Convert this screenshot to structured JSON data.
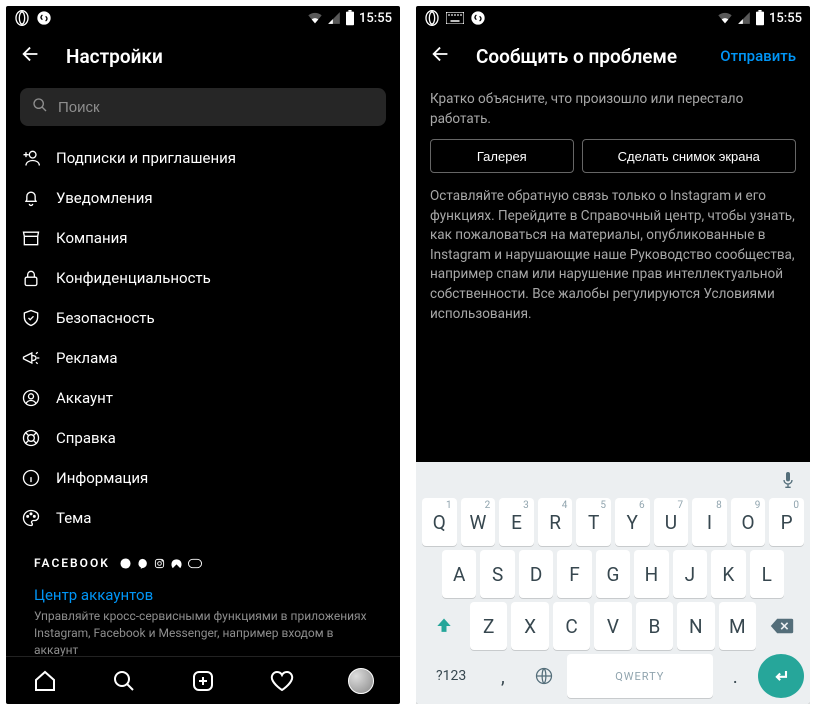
{
  "status": {
    "time": "15:55"
  },
  "left": {
    "title": "Настройки",
    "search_placeholder": "Поиск",
    "items": [
      {
        "label": "Подписки и приглашения"
      },
      {
        "label": "Уведомления"
      },
      {
        "label": "Компания"
      },
      {
        "label": "Конфиденциальность"
      },
      {
        "label": "Безопасность"
      },
      {
        "label": "Реклама"
      },
      {
        "label": "Аккаунт"
      },
      {
        "label": "Справка"
      },
      {
        "label": "Информация"
      },
      {
        "label": "Тема"
      }
    ],
    "facebook_label": "FACEBOOK",
    "accounts_center": "Центр аккаунтов",
    "fb_desc": "Управляйте кросс-сервисными функциями в приложениях Instagram, Facebook и Messenger, например входом в аккаунт"
  },
  "right": {
    "title": "Сообщить о проблеме",
    "send": "Отправить",
    "hint": "Кратко объясните, что произошло или перестало работать.",
    "gallery": "Галерея",
    "screenshot": "Сделать снимок экрана",
    "info": "Оставляйте обратную связь только о Instagram и его функциях. Перейдите в Справочный центр, чтобы узнать, как пожаловаться на материалы, опубликованные в Instagram и нарушающие наше Руководство сообщества, например спам или нарушение прав интеллектуальной собственности. Все жалобы регулируются Условиями использования."
  },
  "keyboard": {
    "row1": [
      "Q",
      "W",
      "E",
      "R",
      "T",
      "Y",
      "U",
      "I",
      "O",
      "P"
    ],
    "row1_sup": [
      "1",
      "2",
      "3",
      "4",
      "5",
      "6",
      "7",
      "8",
      "9",
      "0"
    ],
    "row2": [
      "A",
      "S",
      "D",
      "F",
      "G",
      "H",
      "J",
      "K",
      "L"
    ],
    "row3": [
      "Z",
      "X",
      "C",
      "V",
      "B",
      "N",
      "M"
    ],
    "sym": "?123",
    "space": "QWERTY",
    "comma": ",",
    "dot": "."
  }
}
